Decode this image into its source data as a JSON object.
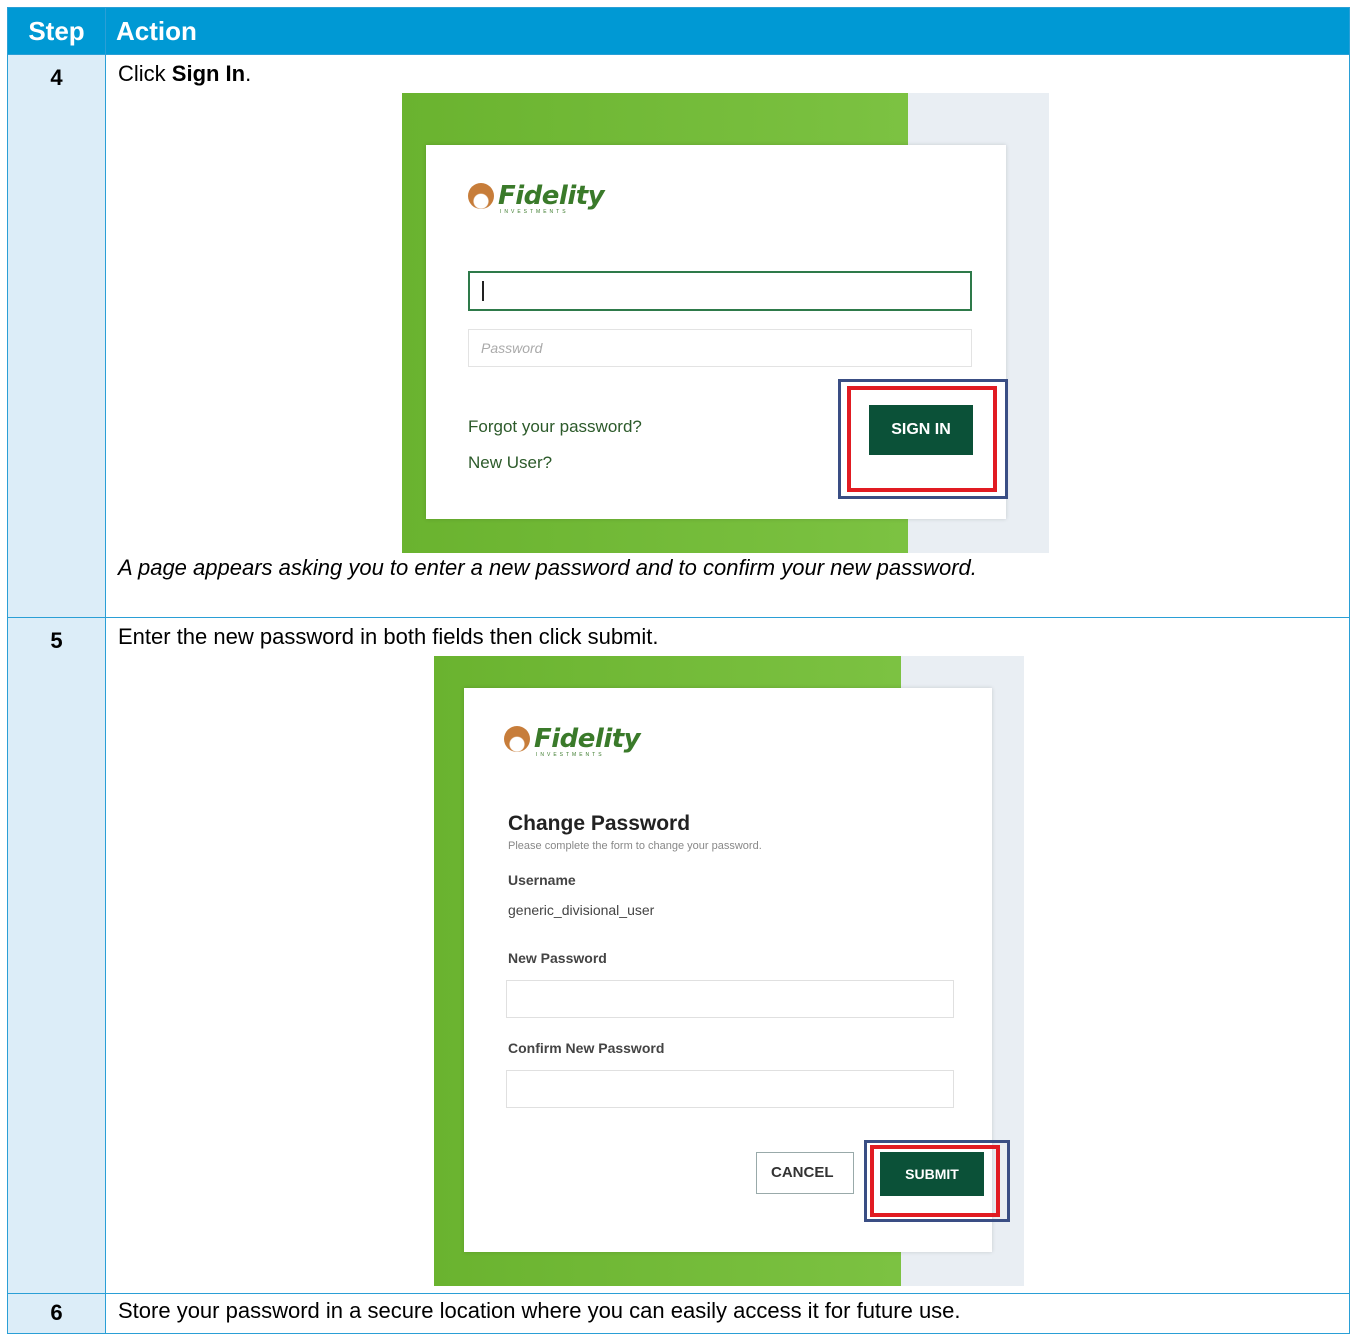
{
  "header": {
    "step_label": "Step",
    "action_label": "Action"
  },
  "steps": [
    {
      "number": "4",
      "instruction_prefix": "Click ",
      "instruction_bold": "Sign In",
      "instruction_suffix": ".",
      "note": "A page appears asking you to enter a new password and to confirm your new password."
    },
    {
      "number": "5",
      "instruction": "Enter the new password in both fields then click submit."
    },
    {
      "number": "6",
      "instruction": "Store your password in a secure location where you can easily access it for future use."
    }
  ],
  "signin_screen": {
    "logo_text": "Fidelity",
    "logo_tagline": "INVESTMENTS",
    "password_placeholder": "Password",
    "forgot_link": "Forgot your password?",
    "new_user_link": "New User?",
    "sign_in_button": "SIGN IN"
  },
  "change_password_screen": {
    "logo_text": "Fidelity",
    "logo_tagline": "INVESTMENTS",
    "title": "Change Password",
    "subtitle": "Please complete the form to change your password.",
    "username_label": "Username",
    "username_value": "generic_divisional_user",
    "new_password_label": "New Password",
    "confirm_password_label": "Confirm New Password",
    "cancel_button": "CANCEL",
    "submit_button": "SUBMIT"
  },
  "colors": {
    "header_blue": "#0099d4",
    "step_bg": "#dcedf8",
    "fidelity_green": "#0b5138",
    "highlight_red": "#e11b22",
    "highlight_navy": "#3a4e84"
  }
}
